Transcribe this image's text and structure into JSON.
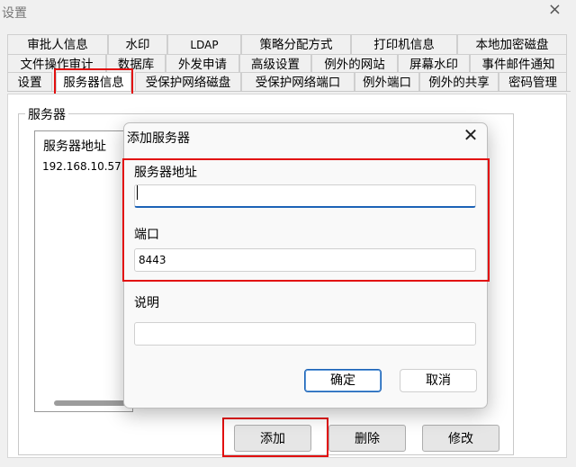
{
  "window": {
    "title": "设置"
  },
  "tabs_row1": [
    "审批人信息",
    "水印",
    "LDAP",
    "策略分配方式",
    "打印机信息",
    "本地加密磁盘"
  ],
  "tabs_row2": [
    "文件操作审计",
    "数据库",
    "外发申请",
    "高级设置",
    "例外的网站",
    "屏幕水印",
    "事件邮件通知"
  ],
  "tabs_row3": [
    "设置",
    "服务器信息",
    "受保护网络磁盘",
    "受保护网络端口",
    "例外端口",
    "例外的共享",
    "密码管理"
  ],
  "group": {
    "label": "服务器",
    "list_header": "服务器地址",
    "list_rows": [
      "192.168.10.57"
    ]
  },
  "buttons": {
    "add": "添加",
    "delete": "删除",
    "modify": "修改"
  },
  "dialog": {
    "title": "添加服务器",
    "server_address_label": "服务器地址",
    "server_address_value": "",
    "port_label": "端口",
    "port_value": "8443",
    "description_label": "说明",
    "description_value": "",
    "ok": "确定",
    "cancel": "取消"
  },
  "colors": {
    "highlight_red": "#e21010",
    "focus_blue": "#1c63b7"
  }
}
